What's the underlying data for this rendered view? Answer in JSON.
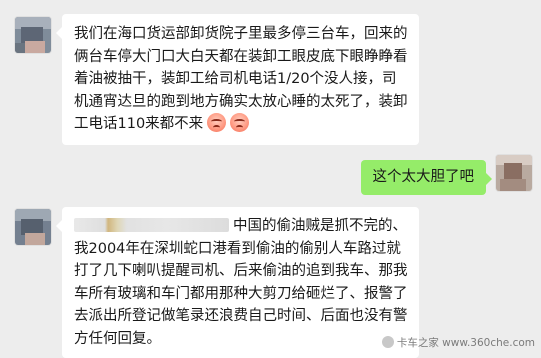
{
  "messages": [
    {
      "side": "left",
      "text": "我们在海口货运部卸货院子里最多停三台车，回来的俩台车停大门口大白天都在装卸工眼皮底下眼睁睁看着油被抽干，装卸工给司机电话1/20个没人接，司机通宵达旦的跑到地方确实太放心睡的太死了，装卸工电话110来都不来",
      "emojis": [
        "angry-face-icon",
        "angry-face-icon"
      ]
    },
    {
      "side": "right",
      "text": "这个太大胆了吧"
    },
    {
      "side": "left",
      "text": "中国的偷油贼是抓不完的、我2004年在深圳蛇口港看到偷油的偷别人车路过就打了几下喇叭提醒司机、后来偷油的追到我车、那我车所有玻璃和车门都用那种大剪刀给砸烂了、报警了去派出所登记做笔录还浪费自己时间、后面也没有警方任何回复。"
    }
  ],
  "watermark": "卡车之家 www.360che.com",
  "colors": {
    "background": "#ededed",
    "left_bubble": "#ffffff",
    "right_bubble": "#95ec69",
    "text": "#191919"
  }
}
